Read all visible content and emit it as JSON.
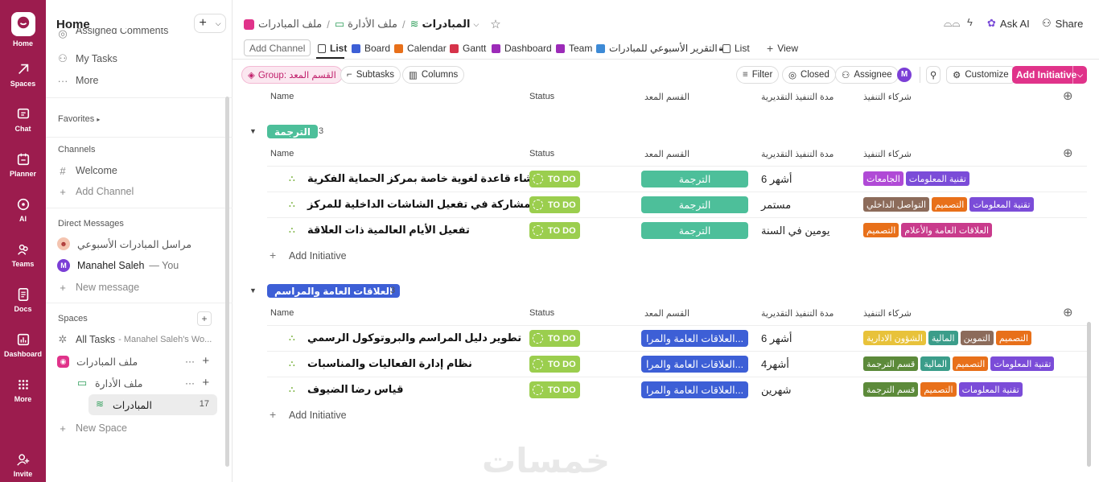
{
  "rail": {
    "home": "Home",
    "spaces": "Spaces",
    "chat": "Chat",
    "planner": "Planner",
    "ai": "AI",
    "teams": "Teams",
    "docs": "Docs",
    "dashboards": "Dashboard",
    "more": "More",
    "invite": "Invite"
  },
  "sidebar": {
    "title": "Home",
    "assigned": "Assigned Comments",
    "my_tasks": "My Tasks",
    "more": "More",
    "favorites": "Favorites",
    "channels": "Channels",
    "welcome": "Welcome",
    "add_channel": "Add Channel",
    "dm": "Direct Messages",
    "dm1": "مراسل المبادرات الأسبوعي",
    "dm2_name": "Manahel Saleh",
    "dm2_you": "— You",
    "new_message": "New message",
    "spaces": "Spaces",
    "all_tasks": "All Tasks",
    "all_tasks_sub": "- Manahel Saleh's Wo...",
    "space1": "ملف المبادرات",
    "folder1": "ملف الأدارة",
    "list1": "المبادرات",
    "list1_count": "17",
    "new_space": "New Space"
  },
  "breadcrumb": {
    "a": "ملف المبادرات",
    "b": "ملف الأدارة",
    "c": "المبادرات"
  },
  "topright": {
    "ask": "Ask AI",
    "share": "Share"
  },
  "views": {
    "add_channel": "Add Channel",
    "list": "List",
    "board": "Board",
    "calendar": "Calendar",
    "gantt": "Gantt",
    "dashboard": "Dashboard",
    "team": "Team",
    "report": "التقرير الأسبوعي للمبادرات",
    "list2": "List",
    "add_view": "View"
  },
  "toolbar": {
    "group": "Group: القسم المعد",
    "subtasks": "Subtasks",
    "columns": "Columns",
    "filter": "Filter",
    "closed": "Closed",
    "assignee": "Assignee",
    "avatar": "M",
    "customize": "Customize",
    "add_initiative": "Add Initiative"
  },
  "columns": {
    "name": "Name",
    "status": "Status",
    "dept": "القسم المعد",
    "duration": "مدة التنفيذ التقديرية",
    "partners": "شركاء التنفيذ"
  },
  "groups": [
    {
      "label": "الترجمة",
      "count": "3",
      "color": "#4dbf9a",
      "rows": [
        {
          "name": "إنشاء قاعدة لغوية خاصة بمركز الحماية الفكرية",
          "status": "TO DO",
          "dept": "الترجمة",
          "duration": "6 أشهر",
          "tags": [
            {
              "t": "الجامعات",
              "c": "#b04ad6"
            },
            {
              "t": "تقنية المعلومات",
              "c": "#7b4cd8"
            }
          ]
        },
        {
          "name": "المشاركة في تفعيل الشاشات الداخلية للمركز",
          "status": "TO DO",
          "dept": "الترجمة",
          "duration": "مستمر",
          "tags": [
            {
              "t": "التواصل الداخلي",
              "c": "#8c6b5a"
            },
            {
              "t": "التصميم",
              "c": "#e8701a"
            },
            {
              "t": "تقنية المعلومات",
              "c": "#7b4cd8"
            }
          ]
        },
        {
          "name": "تفعيل الأيام العالمية ذات العلاقة",
          "status": "TO DO",
          "dept": "الترجمة",
          "duration": "يومين في السنة",
          "tags": [
            {
              "t": "التصميم",
              "c": "#e8701a"
            },
            {
              "t": "العلاقات العامة والأعلام",
              "c": "#c93b8c"
            }
          ]
        }
      ],
      "add": "Add Initiative"
    },
    {
      "label": "العلاقات العامة والمراسم",
      "count": "3",
      "color": "#3d5fd6",
      "rows": [
        {
          "name": "تطوير دليل المراسم والبروتوكول الرسمي",
          "status": "TO DO",
          "dept": "العلاقات العامة والمرا...",
          "duration": "6 أشهر",
          "tags": [
            {
              "t": "الشؤون الادارية",
              "c": "#e8c23a"
            },
            {
              "t": "المالية",
              "c": "#3b9d8a"
            },
            {
              "t": "التموين",
              "c": "#8c6b5a"
            },
            {
              "t": "التصميم",
              "c": "#e8701a"
            }
          ]
        },
        {
          "name": "نظام إدارة الفعاليات والمناسبات",
          "status": "TO DO",
          "dept": "العلاقات العامة والمرا...",
          "duration": "4أشهر",
          "tags": [
            {
              "t": "قسم الترجمة",
              "c": "#5c8a3a"
            },
            {
              "t": "المالية",
              "c": "#3b9d8a"
            },
            {
              "t": "التصميم",
              "c": "#e8701a"
            },
            {
              "t": "تقنية المعلومات",
              "c": "#7b4cd8"
            }
          ]
        },
        {
          "name": "قياس رضا الضيوف",
          "status": "TO DO",
          "dept": "العلاقات العامة والمرا...",
          "duration": "شهرين",
          "tags": [
            {
              "t": "قسم الترجمة",
              "c": "#5c8a3a"
            },
            {
              "t": "التصميم",
              "c": "#e8701a"
            },
            {
              "t": "تقنية المعلومات",
              "c": "#7b4cd8"
            }
          ]
        }
      ],
      "add": "Add Initiative"
    }
  ],
  "watermark": "خمسات",
  "colors": {
    "rail": "#9c1c4e",
    "accent": "#e0338a",
    "status": "#9bce4e"
  }
}
